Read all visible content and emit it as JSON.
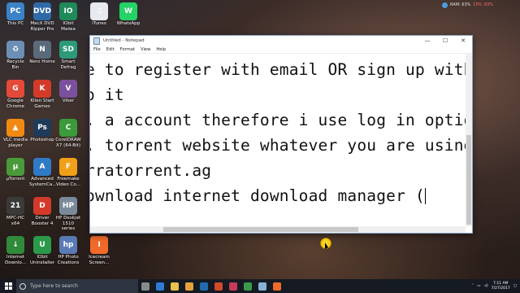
{
  "desktop_icons": [
    {
      "label": "This PC",
      "color": "#3b82c6",
      "glyph": "PC"
    },
    {
      "label": "MacX DVD Ripper Pro",
      "color": "#2f6aa8",
      "glyph": "DVD"
    },
    {
      "label": "IObit Malwa",
      "color": "#1f8a5a",
      "glyph": "IO"
    },
    {
      "label": "iTunes",
      "color": "#e8e8f0",
      "glyph": "♫"
    },
    {
      "label": "WhatsApp",
      "color": "#25d366",
      "glyph": "W"
    },
    {
      "label": "Recycle Bin",
      "color": "#6b8fb5",
      "glyph": "♻"
    },
    {
      "label": "Nero Home",
      "color": "#5a6a7a",
      "glyph": "N"
    },
    {
      "label": "Smart Defrag",
      "color": "#2d9a7a",
      "glyph": "SD"
    },
    {
      "label": "Google Chrome",
      "color": "#e34a3a",
      "glyph": "G"
    },
    {
      "label": "Klien Start Games",
      "color": "#d33a2a",
      "glyph": "K"
    },
    {
      "label": "Viber",
      "color": "#7b519d",
      "glyph": "V"
    },
    {
      "label": "VLC media player",
      "color": "#f08a12",
      "glyph": "▲"
    },
    {
      "label": "Photoshop",
      "color": "#1f3b5a",
      "glyph": "Ps"
    },
    {
      "label": "CorelDRAW X7 (64-Bit)",
      "color": "#3b9a3a",
      "glyph": "C"
    },
    {
      "label": "µTorrent",
      "color": "#4a9a3a",
      "glyph": "µ"
    },
    {
      "label": "Advanced SystemCa...",
      "color": "#2f7ac6",
      "glyph": "A"
    },
    {
      "label": "Freemake Video Co...",
      "color": "#f0a018",
      "glyph": "F"
    },
    {
      "label": "MPC-HC x64",
      "color": "#3a3a3a",
      "glyph": "21"
    },
    {
      "label": "Driver Booster 4",
      "color": "#d33a2a",
      "glyph": "D"
    },
    {
      "label": "HP Deskjet 1510 series",
      "color": "#7a8a9a",
      "glyph": "HP"
    },
    {
      "label": "Internet Downlo...",
      "color": "#2f8a3a",
      "glyph": "↓"
    },
    {
      "label": "IObit Uninstaller",
      "color": "#2a9a4a",
      "glyph": "U"
    },
    {
      "label": "HP Photo Creations",
      "color": "#5a7ab5",
      "glyph": "hp"
    },
    {
      "label": "Icecream Screen...",
      "color": "#f06a2a",
      "glyph": "I"
    }
  ],
  "sysmon": {
    "ram": "RAM: 63%",
    "cpu": "CPU: 83%"
  },
  "notepad": {
    "title": "Untitled - Notepad",
    "menu": [
      "File",
      "Edit",
      "Format",
      "View",
      "Help"
    ],
    "lines": [
      "e to register with email OR sign up with fa",
      "o it",
      ". a account therefore i use log in option",
      ". torrent website whatever you are using",
      "rratorrent.ag",
      "ownload internet download manager ("
    ]
  },
  "taskbar": {
    "search_placeholder": "Type here to search",
    "apps": [
      {
        "name": "task-view",
        "color": "#8a8a8a"
      },
      {
        "name": "edge",
        "color": "#2f7ad6"
      },
      {
        "name": "file-explorer",
        "color": "#e8c04a"
      },
      {
        "name": "chrome",
        "color": "#e3a33a"
      },
      {
        "name": "photoshop",
        "color": "#1f6ab0"
      },
      {
        "name": "powerpoint",
        "color": "#d24a2a"
      },
      {
        "name": "video-app",
        "color": "#c83a5a"
      },
      {
        "name": "app-green",
        "color": "#3a9a4a"
      },
      {
        "name": "notepad",
        "color": "#8ab0d8"
      },
      {
        "name": "icecream",
        "color": "#f06a2a"
      }
    ],
    "clock_time": "7:11 AM",
    "clock_date": "7/27/2017"
  }
}
